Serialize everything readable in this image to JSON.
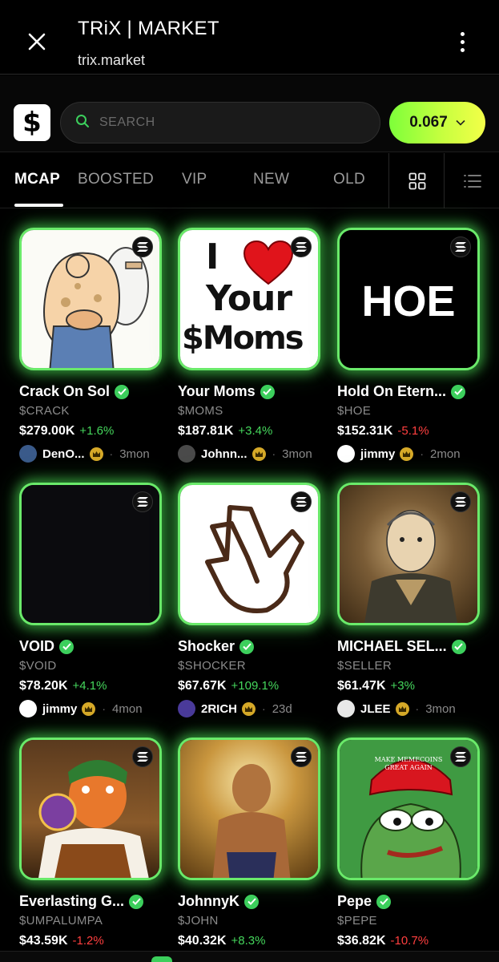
{
  "browser": {
    "title": "TRiX | MARKET",
    "url": "trix.market"
  },
  "header": {
    "logo_glyph": "$",
    "search_placeholder": "SEARCH",
    "balance": "0.067"
  },
  "tabs": [
    {
      "label": "MCAP",
      "active": true
    },
    {
      "label": "BOOSTED",
      "active": false
    },
    {
      "label": "VIP",
      "active": false
    },
    {
      "label": "NEW",
      "active": false
    },
    {
      "label": "OLD",
      "active": false
    }
  ],
  "view_modes": [
    "grid-view-icon",
    "list-view-icon"
  ],
  "tokens": [
    {
      "name": "Crack On Sol",
      "ticker": "$CRACK",
      "mcap": "$279.00K",
      "change": "+1.6%",
      "change_dir": "up",
      "creator": "DenO...",
      "age": "3mon",
      "image": "cartoon-plumber"
    },
    {
      "name": "Your Moms",
      "ticker": "$MOMS",
      "mcap": "$187.81K",
      "change": "+3.4%",
      "change_dir": "up",
      "creator": "Johnn...",
      "age": "3mon",
      "image": "i-heart-your-moms",
      "image_text": [
        "I",
        "Your",
        "$Moms"
      ]
    },
    {
      "name": "Hold On Etern...",
      "ticker": "$HOE",
      "mcap": "$152.31K",
      "change": "-5.1%",
      "change_dir": "down",
      "creator": "jimmy",
      "age": "2mon",
      "image": "hoe-text",
      "image_text": [
        "HOE"
      ]
    },
    {
      "name": "VOID",
      "ticker": "$VOID",
      "mcap": "$78.20K",
      "change": "+4.1%",
      "change_dir": "up",
      "creator": "jimmy",
      "age": "4mon",
      "image": "black-void"
    },
    {
      "name": "Shocker",
      "ticker": "$SHOCKER",
      "mcap": "$67.67K",
      "change": "+109.1%",
      "change_dir": "up",
      "creator": "2RICH",
      "age": "23d",
      "image": "shocker-hand"
    },
    {
      "name": "MICHAEL SEL...",
      "ticker": "$SELLER",
      "mcap": "$61.47K",
      "change": "+3%",
      "change_dir": "up",
      "creator": "JLEE",
      "age": "3mon",
      "image": "sketch-portrait"
    },
    {
      "name": "Everlasting G...",
      "ticker": "$UMPALUMPA",
      "mcap": "$43.59K",
      "change": "-1.2%",
      "change_dir": "down",
      "creator": "",
      "age": "",
      "image": "oompa-loompa"
    },
    {
      "name": "JohnnyK",
      "ticker": "$JOHN",
      "mcap": "$40.32K",
      "change": "+8.3%",
      "change_dir": "up",
      "creator": "",
      "age": "",
      "image": "golden-man"
    },
    {
      "name": "Pepe",
      "ticker": "$PEPE",
      "mcap": "$36.82K",
      "change": "-10.7%",
      "change_dir": "down",
      "creator": "",
      "age": "",
      "image": "pepe-frog",
      "image_text": [
        "MAKE MEMECOINS",
        "GREAT AGAIN"
      ]
    }
  ],
  "colors": {
    "accent_green": "#3ccf5c",
    "glow_green": "#6aea6a",
    "down_red": "#ff3f3f",
    "balance_gradient": [
      "#7dff3a",
      "#f3ff48"
    ]
  }
}
